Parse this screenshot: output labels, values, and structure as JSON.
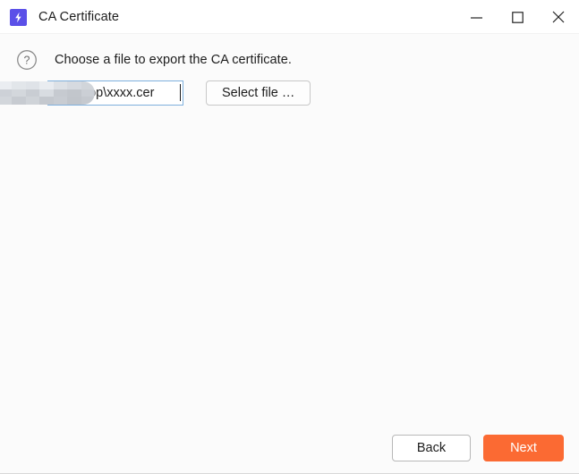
{
  "window": {
    "title": "CA Certificate",
    "app_icon": "lightning-bolt-icon",
    "accent_color": "#5b50e8",
    "controls": {
      "minimize": "minimize-icon",
      "maximize": "maximize-icon",
      "close": "close-icon"
    }
  },
  "main": {
    "help_icon": "question-mark-circle-icon",
    "prompt": "Choose a file to export the CA certificate.",
    "path_field": {
      "value": "\\Desktop\\xxxx.cer",
      "placeholder": "",
      "redacted": true,
      "focused": true,
      "border_color": "#7fb0dd"
    },
    "select_file_label": "Select file …"
  },
  "footer": {
    "back_label": "Back",
    "next_label": "Next",
    "next_color": "#fb6a33"
  }
}
